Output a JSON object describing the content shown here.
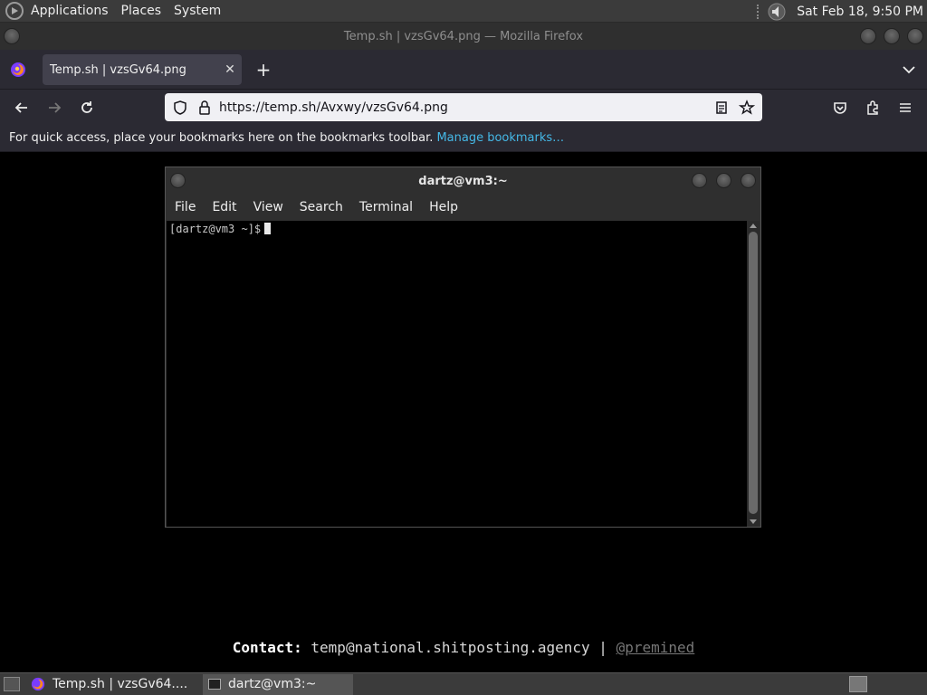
{
  "top_panel": {
    "menus": [
      "Applications",
      "Places",
      "System"
    ],
    "clock": "Sat Feb 18,  9:50 PM"
  },
  "firefox": {
    "window_title": "Temp.sh | vzsGv64.png — Mozilla Firefox",
    "tab_label": "Temp.sh | vzsGv64.png",
    "url": "https://temp.sh/Avxwy/vzsGv64.png",
    "bookmarks_text": "For quick access, place your bookmarks here on the bookmarks toolbar.",
    "bookmarks_link": "Manage bookmarks…"
  },
  "terminal": {
    "title": "dartz@vm3:~",
    "menus": [
      "File",
      "Edit",
      "View",
      "Search",
      "Terminal",
      "Help"
    ],
    "prompt": "[dartz@vm3 ~]$"
  },
  "contact": {
    "label": "Contact:",
    "email": "temp@national.shitposting.agency",
    "separator": "|",
    "handle": "@premined"
  },
  "taskbar": {
    "tasks": [
      "Temp.sh | vzsGv64....",
      "dartz@vm3:~"
    ]
  },
  "colors": {
    "link": "#45b8e6",
    "browser_chrome": "#2b2a33",
    "panel": "#3b3b3b"
  }
}
